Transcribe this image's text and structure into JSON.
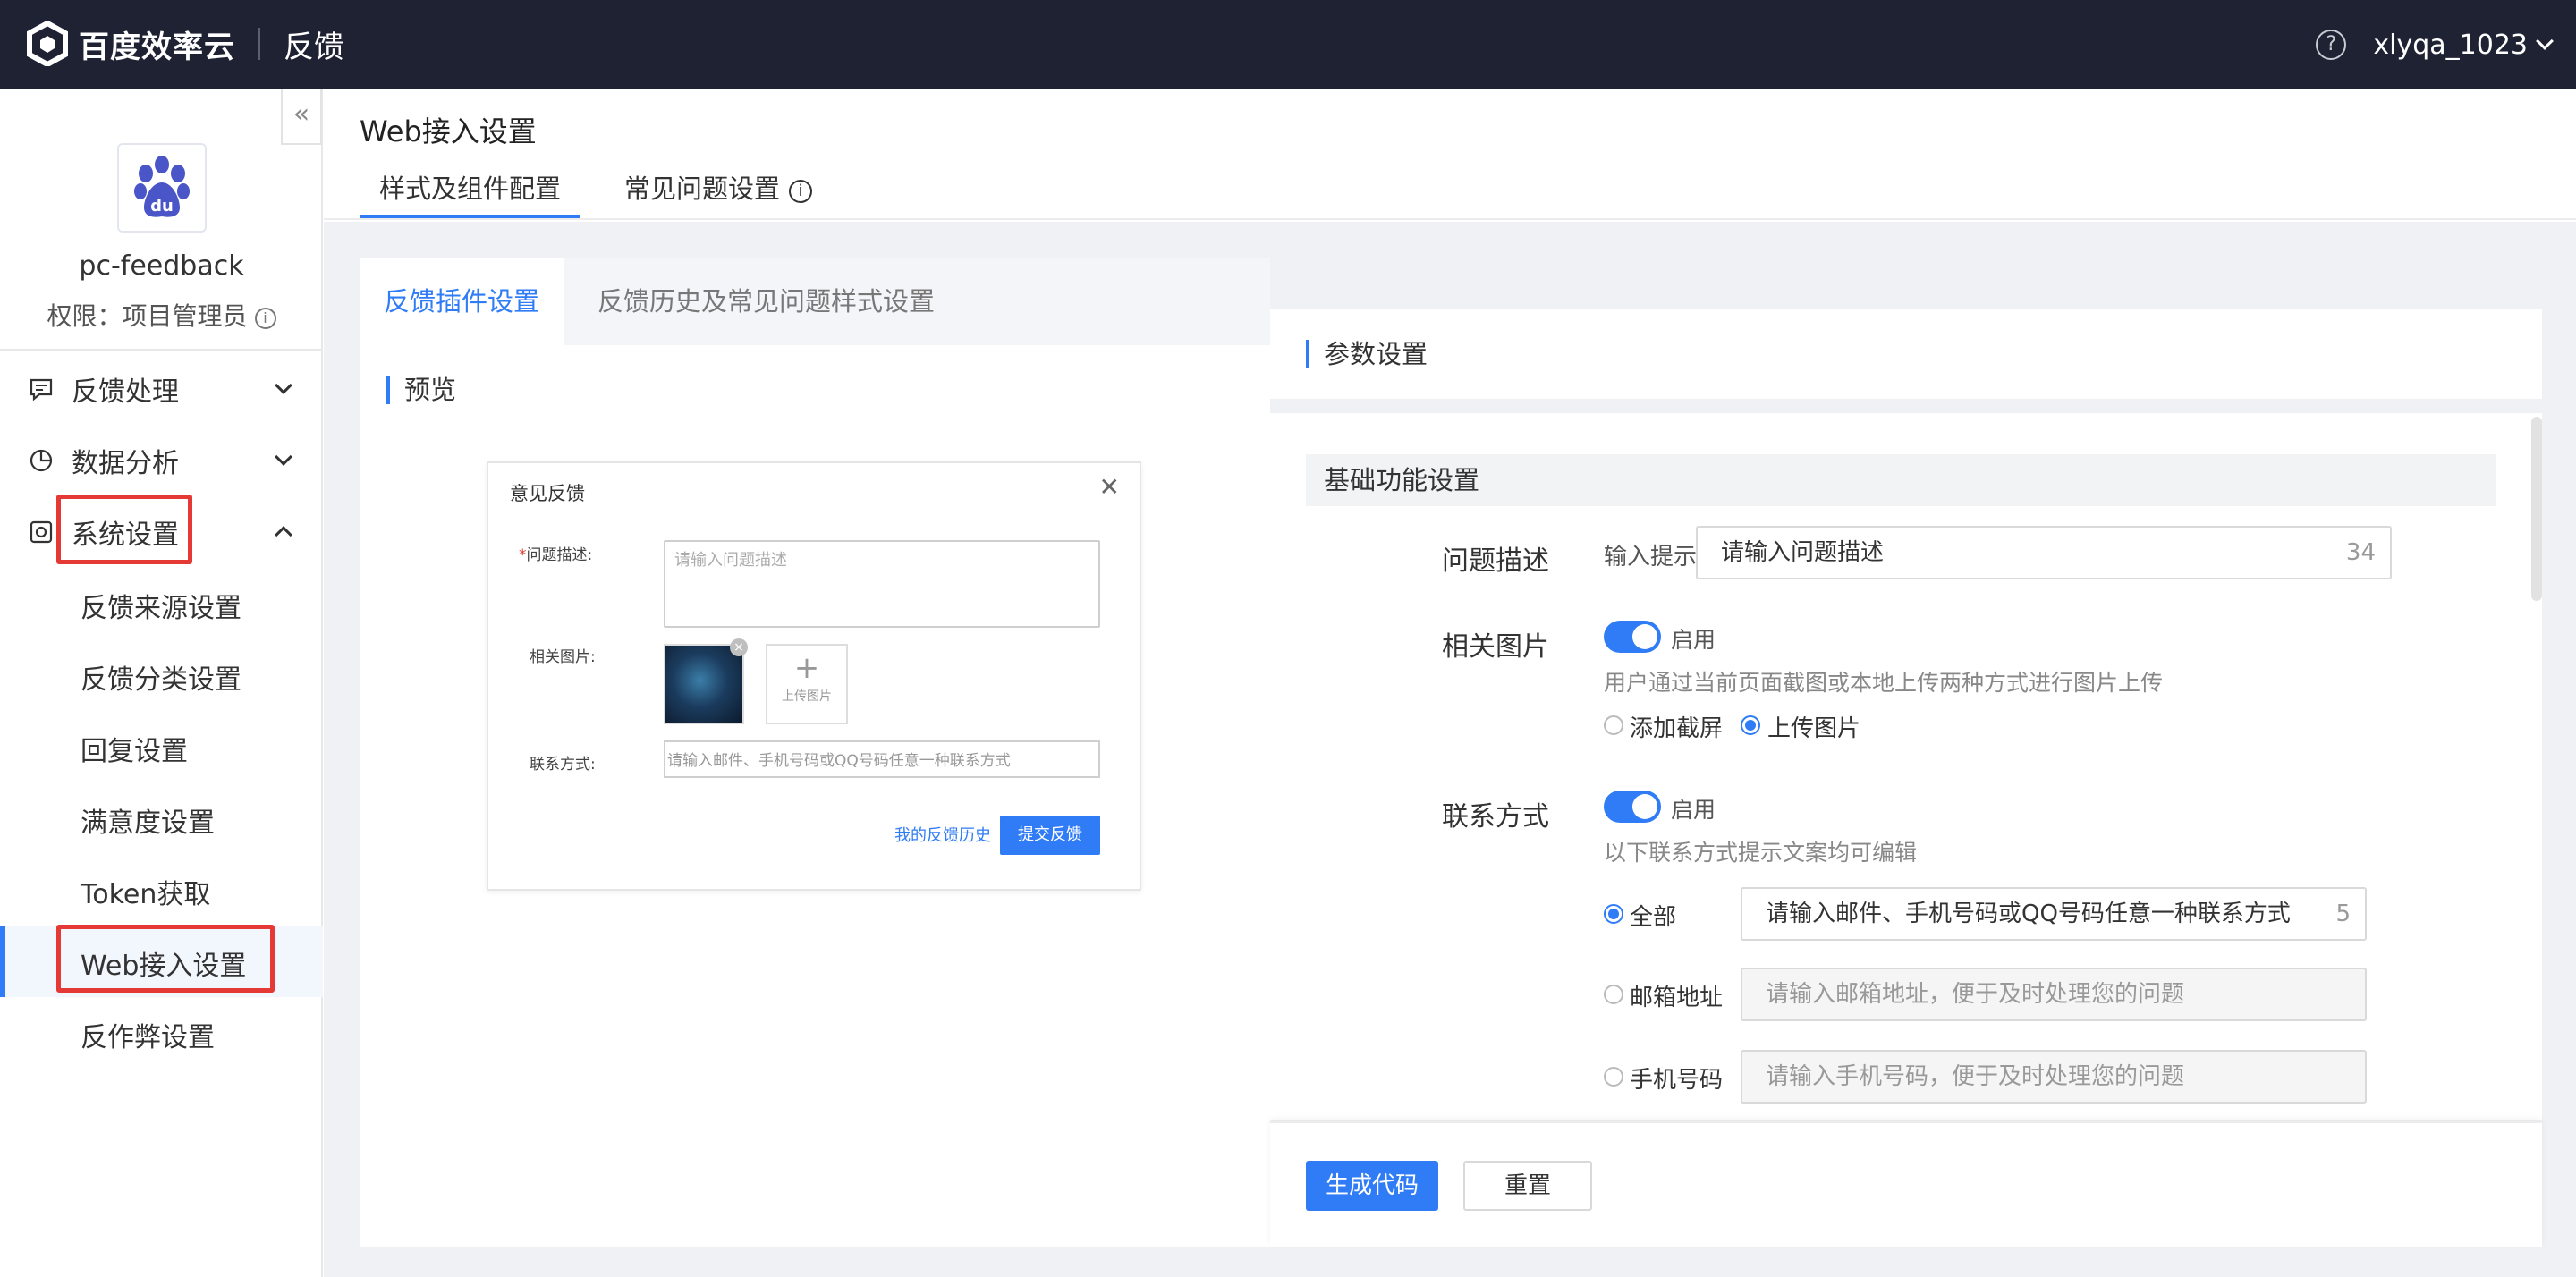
{
  "topbar": {
    "brand": "百度效率云",
    "product": "反馈",
    "help_icon": "question-circle-icon",
    "username": "xlyqa_1023"
  },
  "sidebar": {
    "collapse_icon": "double-chevron-left-icon",
    "collapse_glyph": "«",
    "project_name": "pc-feedback",
    "role_text": "权限：项目管理员",
    "groups": [
      {
        "label": "反馈处理",
        "icon": "message-icon",
        "expanded": false
      },
      {
        "label": "数据分析",
        "icon": "pie-chart-icon",
        "expanded": false
      },
      {
        "label": "系统设置",
        "icon": "settings-icon",
        "expanded": true
      }
    ],
    "sub_items": [
      {
        "label": "反馈来源设置"
      },
      {
        "label": "反馈分类设置"
      },
      {
        "label": "回复设置"
      },
      {
        "label": "满意度设置"
      },
      {
        "label": "Token获取"
      },
      {
        "label": "Web接入设置",
        "active": true
      },
      {
        "label": "反作弊设置"
      }
    ]
  },
  "header": {
    "title": "Web接入设置",
    "tabs": [
      {
        "label": "样式及组件配置",
        "active": true
      },
      {
        "label": "常见问题设置",
        "info_icon": "info-circle-icon"
      }
    ]
  },
  "inner_tabs": [
    {
      "label": "反馈插件设置",
      "active": true
    },
    {
      "label": "反馈历史及常见问题样式设置"
    }
  ],
  "preview": {
    "section_title": "预览",
    "dialog_title": "意见反馈",
    "close_glyph": "✕",
    "problem_label": "问题描述:",
    "problem_placeholder": "请输入问题描述",
    "image_label": "相关图片:",
    "upload_label": "上传图片",
    "contact_label": "联系方式:",
    "contact_placeholder": "请输入邮件、手机号码或QQ号码任意一种联系方式",
    "history_link": "我的反馈历史",
    "submit_label": "提交反馈"
  },
  "params": {
    "section_title": "参数设置",
    "basic_title": "基础功能设置",
    "problem": {
      "label": "问题描述",
      "hint_label": "输入提示",
      "value": "请输入问题描述",
      "count": "34"
    },
    "image": {
      "label": "相关图片",
      "toggle_label": "启用",
      "enabled": true,
      "description": "用户通过当前页面截图或本地上传两种方式进行图片上传",
      "options": [
        {
          "label": "添加截屏",
          "checked": false
        },
        {
          "label": "上传图片",
          "checked": true
        }
      ]
    },
    "contact": {
      "label": "联系方式",
      "toggle_label": "启用",
      "enabled": true,
      "description": "以下联系方式提示文案均可编辑",
      "options": [
        {
          "label": "全部",
          "checked": true,
          "value": "请输入邮件、手机号码或QQ号码任意一种联系方式",
          "count": "5"
        },
        {
          "label": "邮箱地址",
          "checked": false,
          "value": "请输入邮箱地址，便于及时处理您的问题"
        },
        {
          "label": "手机号码",
          "checked": false,
          "value": "请输入手机号码，便于及时处理您的问题"
        }
      ]
    }
  },
  "footer": {
    "generate_label": "生成代码",
    "reset_label": "重置"
  },
  "colors": {
    "accent": "#2f7cf6",
    "topbar": "#1f2233",
    "highlight_box": "#e53935"
  }
}
